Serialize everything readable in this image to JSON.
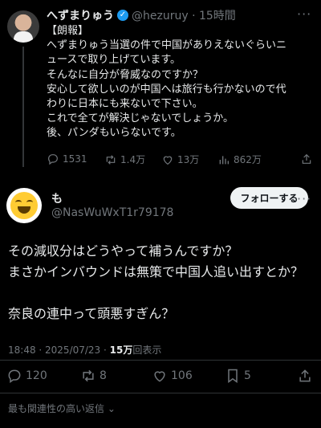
{
  "parent_tweet": {
    "display_name": "へずまりゅう",
    "handle": "@hezuruy",
    "time": "15時間",
    "meta": "@hezuruy · 15時間",
    "lines": [
      "【朗報】",
      "へずまりゅう当選の件で中国がありえないぐらいニ",
      "ュースで取り上げています。",
      "そんなに自分が脅威なのですか？",
      "安心して欲しいのが中国へは旅行も行かないので代",
      "わりに日本にも来ないで下さい。",
      "これで全てが解決じゃないでしょうか。",
      "後、パンダもいらないです。"
    ],
    "stats": {
      "replies": "1531",
      "reposts": "1.4万",
      "likes": "13万",
      "views": "862万"
    }
  },
  "tweet": {
    "display_name": "も",
    "handle": "@NasWuWxT1r79178",
    "follow_label": "フォローする",
    "lines": [
      "その減収分はどうやって補うんですか？",
      "まさかインバウンドは無策で中国人追い出すとか？",
      "",
      "奈良の連中って頭悪すぎん？"
    ],
    "timestamp": "18:48 · 2025/07/23 · ",
    "views_count": "15万",
    "views_label": "回表示",
    "stats": {
      "replies": "120",
      "reposts": "8",
      "likes": "106",
      "bookmarks": "5"
    }
  },
  "relevant_replies_label": "最も関連性の高い返信",
  "icons": {
    "verified": "verified-badge-icon",
    "reply": "reply-icon",
    "repost": "repost-icon",
    "like": "heart-icon",
    "views": "views-icon",
    "bookmark": "bookmark-icon",
    "share": "share-icon",
    "more": "more-icon",
    "chevron": "chevron-down-icon"
  },
  "colors": {
    "background": "#000000",
    "text": "#e7e9ea",
    "secondary": "#71767b",
    "verified": "#1d9bf0",
    "follow_button_bg": "#eff3f4"
  }
}
